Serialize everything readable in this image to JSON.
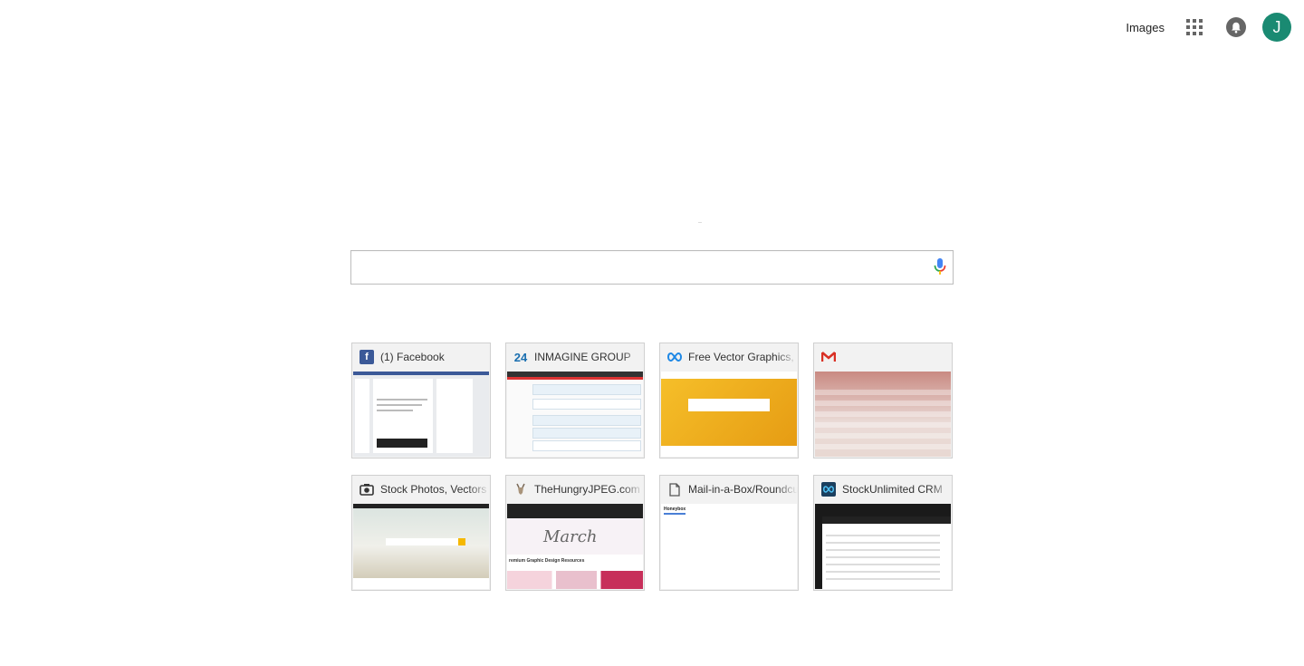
{
  "topbar": {
    "images_label": "Images",
    "apps_icon": "apps-grid-icon",
    "notifications_icon": "bell-icon",
    "avatar_letter": "J",
    "avatar_color": "#1a8a72"
  },
  "search": {
    "value": "",
    "placeholder": "",
    "mic_icon": "microphone-icon"
  },
  "tiles": [
    {
      "title": "(1) Facebook",
      "favicon": "facebook-icon"
    },
    {
      "title": "INMAGINE GROUP",
      "favicon": "inmagine-24-icon"
    },
    {
      "title": "Free Vector Graphics, ",
      "favicon": "infinity-icon"
    },
    {
      "title": "",
      "favicon": "gmail-icon"
    },
    {
      "title": "Stock Photos, Vectors",
      "favicon": "camera-icon"
    },
    {
      "title": "TheHungryJPEG.com",
      "favicon": "deer-icon"
    },
    {
      "title": "Mail-in-a-Box/Roundcu",
      "favicon": "document-icon"
    },
    {
      "title": "StockUnlimited CRM",
      "favicon": "stockunlimited-icon"
    }
  ],
  "thumb_text": {
    "hungry_banner": "March",
    "hungry_caption": "remium Graphic Design Resources",
    "mailbox_heading": "Honeybox"
  }
}
